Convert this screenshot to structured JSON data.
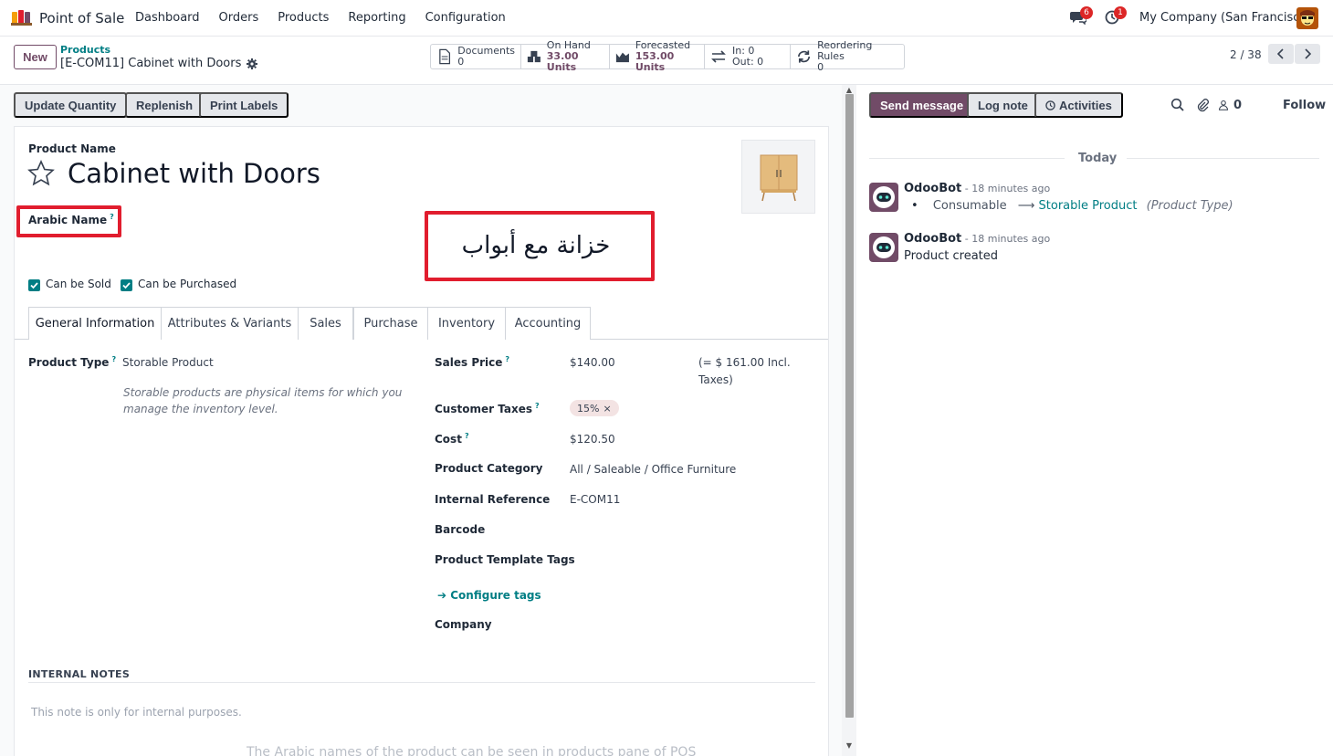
{
  "navbar": {
    "app_name": "Point of Sale",
    "menu": [
      "Dashboard",
      "Orders",
      "Products",
      "Reporting",
      "Configuration"
    ],
    "chat_count": "6",
    "activity_count": "1",
    "company": "My Company (San Francisco)"
  },
  "control": {
    "new_label": "New",
    "breadcrumb_parent": "Products",
    "breadcrumb_current": "[E-COM11] Cabinet with Doors",
    "smart_buttons": [
      {
        "label": "Documents",
        "value": "0",
        "icon": "document-icon"
      },
      {
        "label": "On Hand",
        "value": "33.00 Units",
        "icon": "cubes-icon"
      },
      {
        "label": "Forecasted",
        "value": "153.00 Units",
        "icon": "area-chart-icon"
      },
      {
        "label": "In: 0",
        "value": "Out: 0",
        "icon": "exchange-icon"
      },
      {
        "label": "Reordering Rules",
        "value": "0",
        "icon": "refresh-icon"
      }
    ],
    "pager": "2 / 38"
  },
  "actions": {
    "update_quantity": "Update Quantity",
    "replenish": "Replenish",
    "print_labels": "Print Labels"
  },
  "form": {
    "product_name_label": "Product Name",
    "product_name": "Cabinet with Doors",
    "arabic_name_label": "Arabic Name",
    "arabic_name_value": "خزانة مع أبواب",
    "can_be_sold": "Can be Sold",
    "can_be_purchased": "Can be Purchased",
    "tabs": [
      "General Information",
      "Attributes & Variants",
      "Sales",
      "Purchase",
      "Inventory",
      "Accounting"
    ],
    "product_type_label": "Product Type",
    "product_type": "Storable Product",
    "product_type_help_1": "Storable products are physical items for which you",
    "product_type_help_2": "manage the inventory level.",
    "sales_price_label": "Sales Price",
    "sales_price": "$140.00",
    "incl_taxes_1": "(= $ 161.00 Incl.",
    "incl_taxes_2": "Taxes)",
    "customer_taxes_label": "Customer Taxes",
    "customer_tax": "15%",
    "cost_label": "Cost",
    "cost": "$120.50",
    "category_label": "Product Category",
    "category": "All / Saleable / Office Furniture",
    "internal_ref_label": "Internal Reference",
    "internal_ref": "E-COM11",
    "barcode_label": "Barcode",
    "tags_label": "Product Template Tags",
    "configure_tags": "Configure tags",
    "company_label": "Company",
    "internal_notes": "INTERNAL NOTES",
    "notes_placeholder": "This note is only for internal purposes."
  },
  "bottom_text": "The Arabic names of the product can be seen in products pane of POS",
  "chatter": {
    "send_message": "Send message",
    "log_note": "Log note",
    "activities": "Activities",
    "followers_count": "0",
    "follow": "Follow",
    "today": "Today",
    "messages": [
      {
        "author": "OdooBot",
        "meta": " - 18 minutes ago",
        "from": "Consumable",
        "to": "Storable Product",
        "field": "(Product Type)"
      },
      {
        "author": "OdooBot",
        "meta": " - 18 minutes ago",
        "body": "Product created"
      }
    ]
  },
  "colors": {
    "brand": "#714b67",
    "teal": "#017e84",
    "highlight": "#e11d2e"
  }
}
